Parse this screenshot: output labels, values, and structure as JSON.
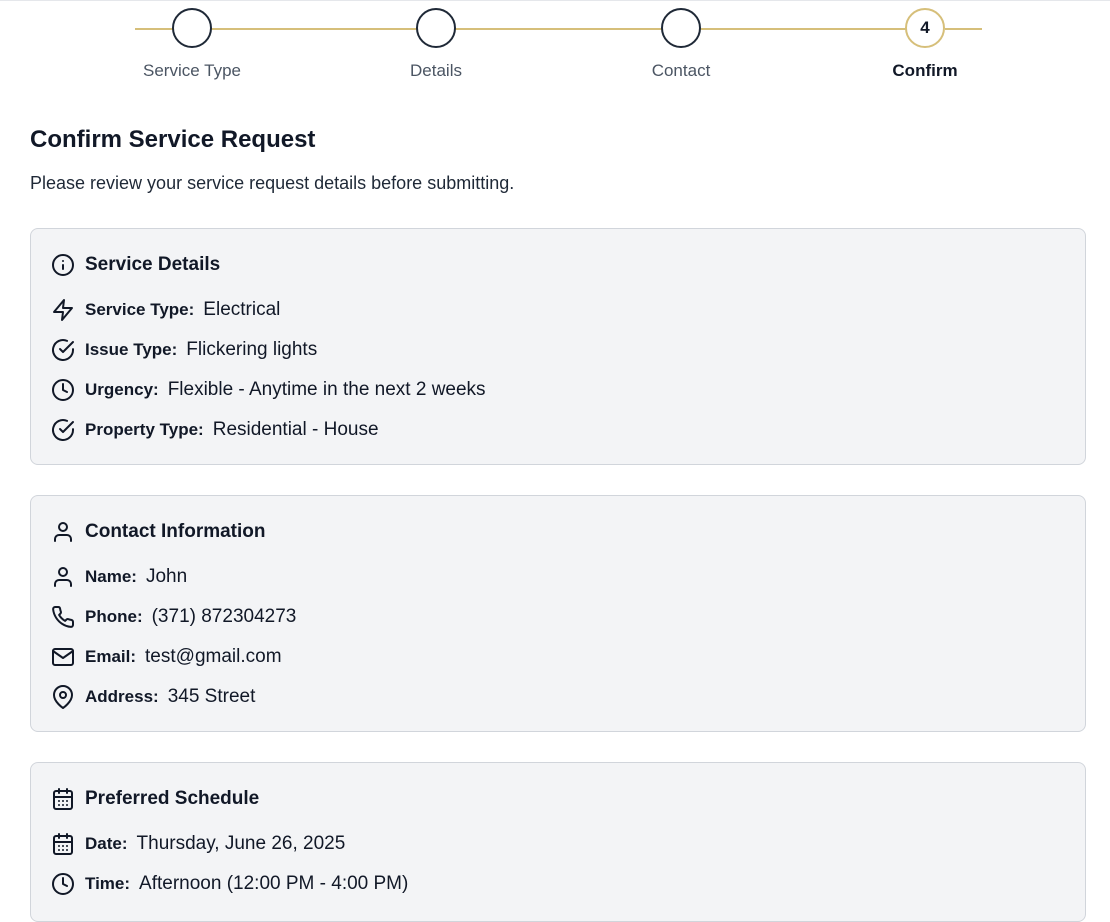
{
  "stepper": {
    "steps": [
      {
        "label": "Service Type",
        "number": ""
      },
      {
        "label": "Details",
        "number": ""
      },
      {
        "label": "Contact",
        "number": ""
      },
      {
        "label": "Confirm",
        "number": "4"
      }
    ],
    "active_index": 3,
    "line_color": "#d6bf7a"
  },
  "page": {
    "title": "Confirm Service Request",
    "subtitle": "Please review your service request details before submitting."
  },
  "service_details": {
    "title": "Service Details",
    "icon": "info-icon",
    "rows": [
      {
        "icon": "bolt-icon",
        "label": "Service Type:",
        "value": "Electrical"
      },
      {
        "icon": "check-circle-icon",
        "label": "Issue Type:",
        "value": "Flickering lights"
      },
      {
        "icon": "clock-icon",
        "label": "Urgency:",
        "value": "Flexible - Anytime in the next 2 weeks"
      },
      {
        "icon": "check-circle-icon",
        "label": "Property Type:",
        "value": "Residential - House"
      }
    ]
  },
  "contact_information": {
    "title": "Contact Information",
    "icon": "user-icon",
    "rows": [
      {
        "icon": "user-icon",
        "label": "Name:",
        "value": "John"
      },
      {
        "icon": "phone-icon",
        "label": "Phone:",
        "value": "(371) 872304273"
      },
      {
        "icon": "mail-icon",
        "label": "Email:",
        "value": "test@gmail.com"
      },
      {
        "icon": "map-pin-icon",
        "label": "Address:",
        "value": "345 Street"
      }
    ]
  },
  "preferred_schedule": {
    "title": "Preferred Schedule",
    "icon": "calendar-icon",
    "rows": [
      {
        "icon": "calendar-icon",
        "label": "Date:",
        "value": "Thursday, June 26, 2025"
      },
      {
        "icon": "clock-icon",
        "label": "Time:",
        "value": "Afternoon (12:00 PM - 4:00 PM)"
      }
    ]
  },
  "colors": {
    "accent": "#d6bf7a",
    "card_background": "#f3f4f6",
    "card_border": "#d1d5db",
    "text": "#111827"
  }
}
